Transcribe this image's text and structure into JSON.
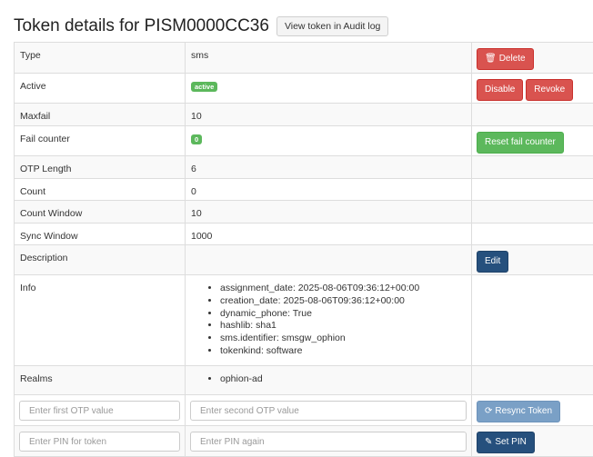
{
  "header": {
    "title": "Token details for PISM0000CC36",
    "audit_button": "View token in Audit log"
  },
  "rows": {
    "type": {
      "label": "Type",
      "value": "sms",
      "action": "Delete"
    },
    "active": {
      "label": "Active",
      "badge": "active",
      "disable": "Disable",
      "revoke": "Revoke"
    },
    "maxfail": {
      "label": "Maxfail",
      "value": "10"
    },
    "failcounter": {
      "label": "Fail counter",
      "badge": "0",
      "action": "Reset fail counter"
    },
    "otplen": {
      "label": "OTP Length",
      "value": "6"
    },
    "count": {
      "label": "Count",
      "value": "0"
    },
    "countwindow": {
      "label": "Count Window",
      "value": "10"
    },
    "syncwindow": {
      "label": "Sync Window",
      "value": "1000"
    },
    "description": {
      "label": "Description",
      "value": "",
      "action": "Edit"
    },
    "info": {
      "label": "Info",
      "items": [
        "assignment_date: 2025-08-06T09:36:12+00:00",
        "creation_date: 2025-08-06T09:36:12+00:00",
        "dynamic_phone: True",
        "hashlib: sha1",
        "sms.identifier: smsgw_ophion",
        "tokenkind: software"
      ]
    },
    "realms": {
      "label": "Realms",
      "items": [
        "ophion-ad"
      ]
    }
  },
  "resync": {
    "otp1_placeholder": "Enter first OTP value",
    "otp2_placeholder": "Enter second OTP value",
    "button": "Resync Token"
  },
  "setpin": {
    "pin1_placeholder": "Enter PIN for token",
    "pin2_placeholder": "Enter PIN again",
    "button": "Set PIN"
  },
  "icons": {
    "delete": "trash-icon",
    "resync": "refresh-icon",
    "setpin": "pin-icon"
  },
  "colors": {
    "danger": "#d9534f",
    "success": "#5cb85c",
    "primary": "#337ab7",
    "navy": "#26507d"
  }
}
